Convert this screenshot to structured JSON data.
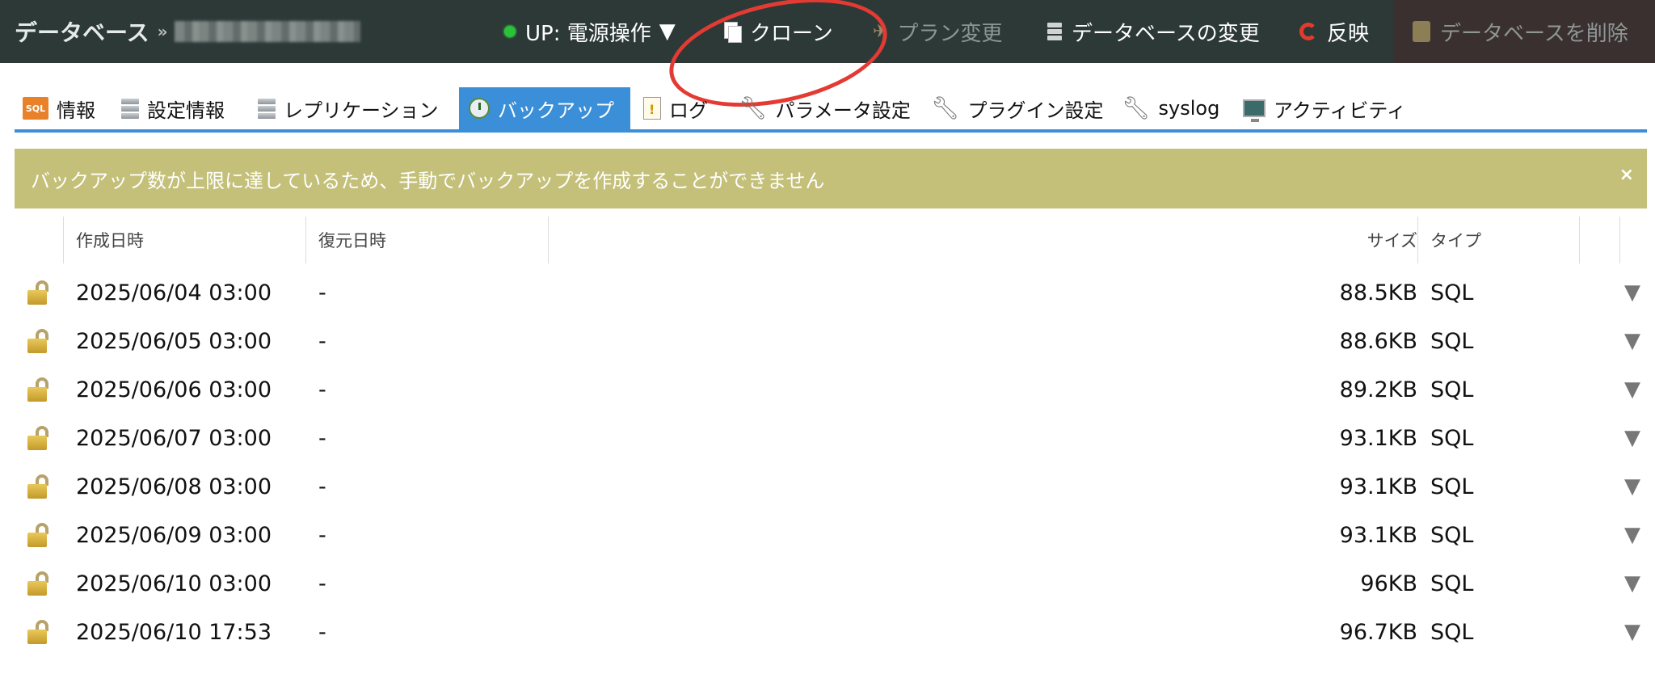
{
  "header": {
    "crumb_label": "データベース",
    "crumb_sep": "»",
    "status_label": "UP: 電源操作",
    "status_arrow": "▼",
    "clone_label": "クローン",
    "plan_label": "プラン変更",
    "change_db_label": "データベースの変更",
    "reflect_label": "反映",
    "delete_label": "データベースを削除"
  },
  "tabs": [
    {
      "label": "情報"
    },
    {
      "label": "設定情報"
    },
    {
      "label": "レプリケーション"
    },
    {
      "label": "バックアップ"
    },
    {
      "label": "ログ"
    },
    {
      "label": "パラメータ設定"
    },
    {
      "label": "プラグイン設定"
    },
    {
      "label": "syslog"
    },
    {
      "label": "アクティビティ"
    }
  ],
  "sql_icon_text": "SQL",
  "alert": {
    "message": "バックアップ数が上限に達しているため、手動でバックアップを作成することができません",
    "close": "×"
  },
  "table": {
    "columns": {
      "created": "作成日時",
      "restored": "復元日時",
      "size": "サイズ",
      "type": "タイプ"
    },
    "rows": [
      {
        "created": "2025/06/04 03:00",
        "restored": "-",
        "size": "88.5KB",
        "type": "SQL"
      },
      {
        "created": "2025/06/05 03:00",
        "restored": "-",
        "size": "88.6KB",
        "type": "SQL"
      },
      {
        "created": "2025/06/06 03:00",
        "restored": "-",
        "size": "89.2KB",
        "type": "SQL"
      },
      {
        "created": "2025/06/07 03:00",
        "restored": "-",
        "size": "93.1KB",
        "type": "SQL"
      },
      {
        "created": "2025/06/08 03:00",
        "restored": "-",
        "size": "93.1KB",
        "type": "SQL"
      },
      {
        "created": "2025/06/09 03:00",
        "restored": "-",
        "size": "93.1KB",
        "type": "SQL"
      },
      {
        "created": "2025/06/10 03:00",
        "restored": "-",
        "size": "96KB",
        "type": "SQL"
      },
      {
        "created": "2025/06/10 17:53",
        "restored": "-",
        "size": "96.7KB",
        "type": "SQL"
      }
    ],
    "row_menu_glyph": "▼"
  },
  "colors": {
    "topbar": "#2c3937",
    "tab_active": "#3b8fd8",
    "alert_bg": "#c4c07a",
    "annotation": "#e33b33"
  }
}
